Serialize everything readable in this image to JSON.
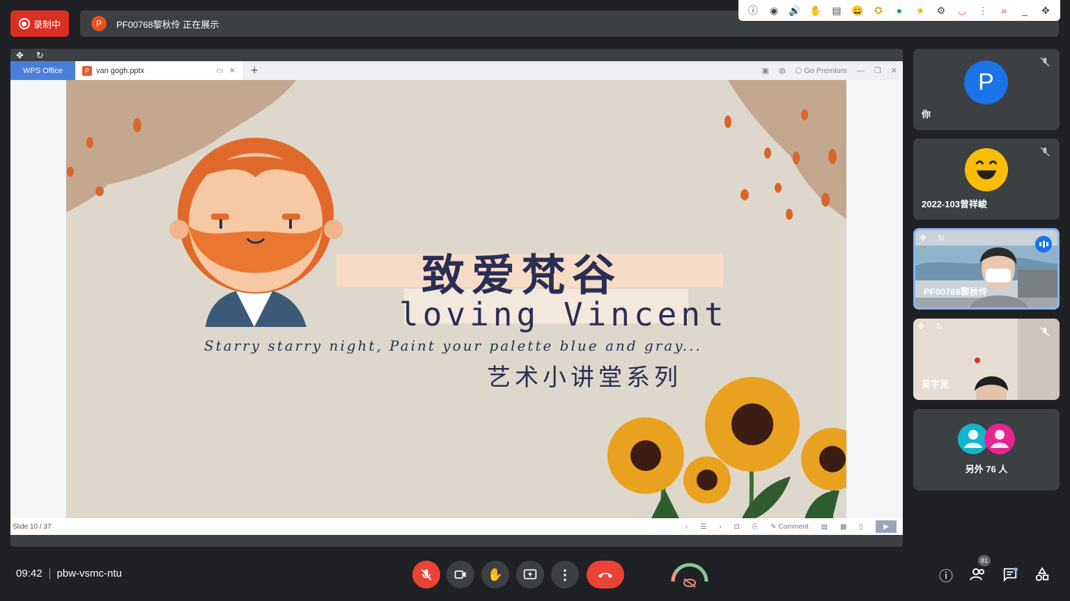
{
  "recording": {
    "label": "录制中"
  },
  "presenter": {
    "avatar_letter": "P",
    "text": "PF00768黎秋伶 正在展示"
  },
  "extensions": [
    "info-icon",
    "eye-icon",
    "speaker-icon",
    "hand-icon",
    "clipboard-icon",
    "emoji-icon",
    "badge-icon",
    "chat-icon",
    "star-icon",
    "gear-icon",
    "smile-icon",
    "more-icon",
    "forward-icon",
    "minimize-icon",
    "move-icon"
  ],
  "wps": {
    "brand": "WPS Office",
    "tab_title": "van gogh.pptx",
    "premium": "Go Premium",
    "slide_status": "Slide 10 / 37",
    "comment": "Comment"
  },
  "slide": {
    "title_cn": "致爱梵谷",
    "title_en": "loving Vincent",
    "subtitle_en": "Starry starry night, Paint your palette blue and gray...",
    "subtitle_cn": "艺术小讲堂系列"
  },
  "participants": [
    {
      "name": "你",
      "avatar_letter": "P",
      "muted": true
    },
    {
      "name": "2022-103曾祥峻",
      "muted": true
    },
    {
      "name": "PF00768黎秋伶",
      "speaking": true
    },
    {
      "name": "吴宇览",
      "muted": true
    },
    {
      "name": "另外 76 人"
    }
  ],
  "meeting": {
    "time": "09:42",
    "code": "pbw-vsmc-ntu",
    "participant_count": "81"
  },
  "colors": {
    "accent": "#1a73e8",
    "danger": "#ea4335",
    "bg": "#202124",
    "tile": "#3c4043"
  }
}
